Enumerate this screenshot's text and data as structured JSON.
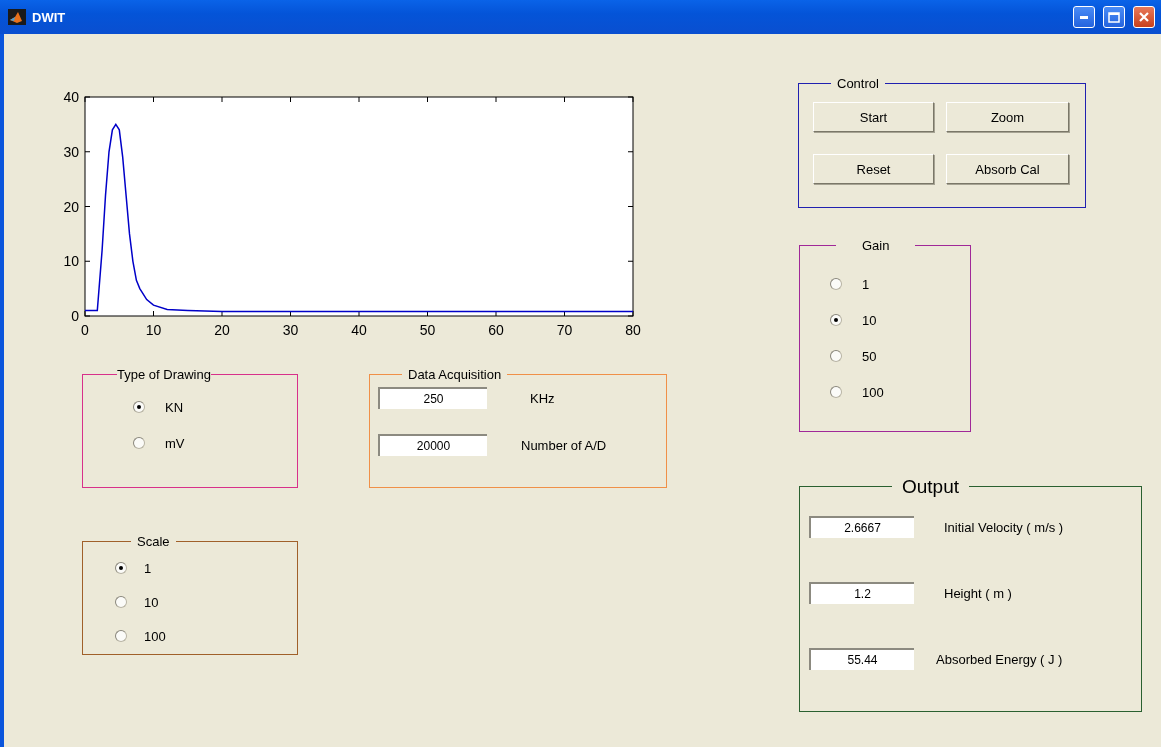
{
  "window": {
    "title": "DWIT"
  },
  "chart": {
    "chart_data": {
      "type": "line",
      "x": [
        0,
        1.8,
        2.5,
        3,
        3.5,
        4,
        4.5,
        5,
        5.5,
        6,
        6.5,
        7,
        7.5,
        8,
        9,
        10,
        12,
        15,
        20,
        30,
        40,
        50,
        60,
        70,
        80
      ],
      "series": [
        {
          "color": "#0000c8",
          "values": [
            1,
            1,
            12,
            22,
            30,
            34,
            35,
            34,
            29,
            22,
            15,
            10,
            6.5,
            5,
            3,
            2,
            1.2,
            1,
            0.8,
            0.8,
            0.8,
            0.8,
            0.8,
            0.8,
            0.8
          ]
        }
      ],
      "xlim": [
        0,
        80
      ],
      "ylim": [
        0,
        40
      ],
      "xticks": [
        0,
        10,
        20,
        30,
        40,
        50,
        60,
        70,
        80
      ],
      "yticks": [
        0,
        10,
        20,
        30,
        40
      ]
    }
  },
  "type_of_drawing": {
    "title": "Type of Drawing",
    "options": [
      {
        "label": "KN",
        "selected": true
      },
      {
        "label": "mV",
        "selected": false
      }
    ]
  },
  "data_acquisition": {
    "title": "Data Acquisition",
    "fields": [
      {
        "value": "250",
        "label": "KHz"
      },
      {
        "value": "20000",
        "label": "Number of A/D"
      }
    ]
  },
  "scale": {
    "title": "Scale",
    "options": [
      {
        "label": "1",
        "selected": true
      },
      {
        "label": "10",
        "selected": false
      },
      {
        "label": "100",
        "selected": false
      }
    ]
  },
  "control": {
    "title": "Control",
    "buttons": [
      "Start",
      "Zoom",
      "Reset",
      "Absorb Cal"
    ]
  },
  "gain": {
    "title": "Gain",
    "options": [
      {
        "label": "1",
        "selected": false
      },
      {
        "label": "10",
        "selected": true
      },
      {
        "label": "50",
        "selected": false
      },
      {
        "label": "100",
        "selected": false
      }
    ]
  },
  "output": {
    "title": "Output",
    "fields": [
      {
        "value": "2.6667",
        "label": "Initial Velocity ( m/s )"
      },
      {
        "value": "1.2",
        "label": "Height ( m )"
      },
      {
        "value": "55.44",
        "label": "Absorbed Energy ( J )"
      }
    ]
  }
}
